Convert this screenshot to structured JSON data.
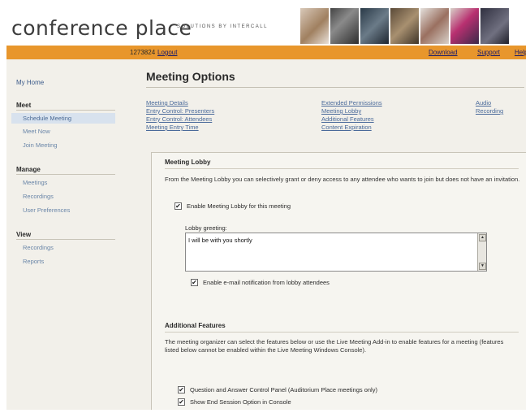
{
  "header": {
    "logo": "conference place",
    "tagline": "SOLUTIONS BY INTERCALL"
  },
  "topbar": {
    "user_id": "1273824",
    "logout": "Logout",
    "download": "Download",
    "support": "Support",
    "help": "Help"
  },
  "sidebar": {
    "my_home": "My Home",
    "meet": {
      "title": "Meet",
      "items": [
        "Schedule Meeting",
        "Meet Now",
        "Join Meeting"
      ]
    },
    "manage": {
      "title": "Manage",
      "items": [
        "Meetings",
        "Recordings",
        "User Preferences"
      ]
    },
    "view": {
      "title": "View",
      "items": [
        "Recordings",
        "Reports"
      ]
    }
  },
  "main": {
    "title": "Meeting Options",
    "option_links": {
      "col1": [
        "Meeting Details",
        "Entry Control: Presenters",
        "Entry Control: Attendees",
        "Meeting Entry Time"
      ],
      "col2": [
        "Extended Permissions",
        "Meeting Lobby",
        "Additional Features",
        "Content Expiration"
      ],
      "col3": [
        "Audio",
        "Recording"
      ]
    },
    "lobby": {
      "heading": "Meeting Lobby",
      "description": "From the Meeting Lobby you can selectively grant or deny access to any attendee who wants to join but does not have an invitation.",
      "enable_label": "Enable Meeting Lobby for this meeting",
      "enable_checked": true,
      "greeting_label": "Lobby greeting:",
      "greeting_value": "I will be with you shortly",
      "notify_label": "Enable e-mail notification from lobby attendees",
      "notify_checked": true
    },
    "additional": {
      "heading": "Additional Features",
      "description": "The meeting organizer can select the features below or use the Live Meeting Add-in to enable features for a meeting (features listed below cannot be enabled within the Live Meeting Windows Console).",
      "qa_label": "Question and Answer Control Panel (Auditorium Place meetings only)",
      "qa_checked": true,
      "end_label": "Show End Session Option in Console",
      "end_checked": true
    }
  }
}
